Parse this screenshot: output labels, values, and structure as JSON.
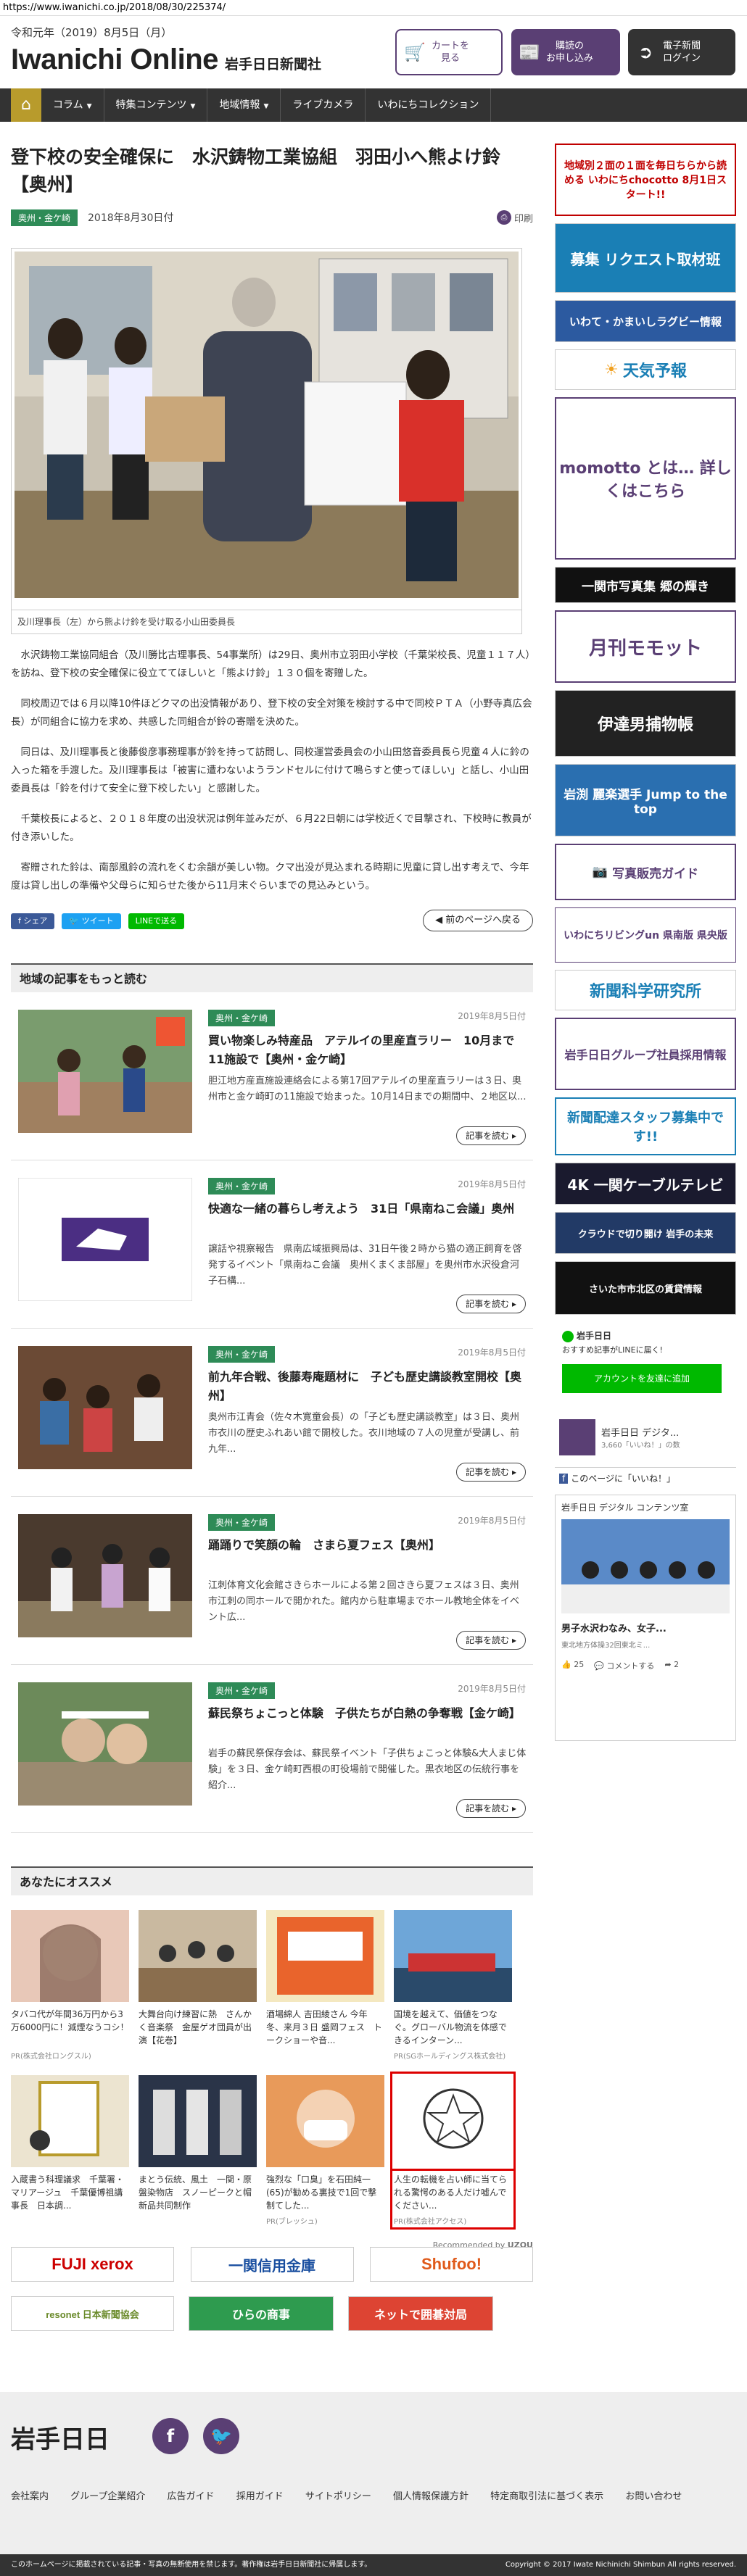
{
  "browser_url": "https://www.iwanichi.co.jp/2018/08/30/225374/",
  "header": {
    "date": "令和元年（2019）8月5日（月）",
    "logo": "Iwanichi Online",
    "logo_jp": "岩手日日新聞社",
    "buttons": [
      {
        "label": "カートを\n見る",
        "icon": "cart-icon"
      },
      {
        "label": "購読の\nお申し込み",
        "icon": "newspaper-icon"
      },
      {
        "label": "電子新聞\nログイン",
        "icon": "login-icon"
      }
    ]
  },
  "nav": [
    "コラム",
    "特集コンテンツ",
    "地域情報",
    "ライブカメラ",
    "いわにちコレクション"
  ],
  "article": {
    "title": "登下校の安全確保に　水沢鋳物工業協組　羽田小へ熊よけ鈴【奥州】",
    "tag": "奥州・金ケ崎",
    "date": "2018年8月30日付",
    "print": "印刷",
    "caption": "及川理事長（左）から熊よけ鈴を受け取る小山田委員長",
    "paragraphs": [
      "水沢鋳物工業協同組合（及川勝比古理事長、54事業所）は29日、奥州市立羽田小学校（千葉栄校長、児童１１７人）を訪ね、登下校の安全確保に役立ててほしいと「熊よけ鈴」１３０個を寄贈した。",
      "同校周辺では６月以降10件ほどクマの出没情報があり、登下校の安全対策を検討する中で同校ＰＴＡ（小野寺真広会長）が同組合に協力を求め、共感した同組合が鈴の寄贈を決めた。",
      "同日は、及川理事長と後藤俊彦事務理事が鈴を持って訪問し、同校運営委員会の小山田悠音委員長ら児童４人に鈴の入った箱を手渡した。及川理事長は「被害に遭わないようランドセルに付けて鳴らすと使ってほしい」と話し、小山田委員長は「鈴を付けて安全に登下校したい」と感謝した。",
      "千葉校長によると、２０１８年度の出没状況は例年並みだが、６月22日朝には学校近くで目撃され、下校時に教員が付き添いした。",
      "寄贈された鈴は、南部風鈴の流れをくむ余韻が美しい物。クマ出没が見込まれる時期に児童に貸し出す考えで、今年度は貸し出しの準備や父母らに知らせた後から11月末ぐらいまでの見込みという。"
    ],
    "share": [
      "シェア",
      "ツイート",
      "LINEで送る"
    ],
    "back": "前のページへ戻る"
  },
  "local_section": {
    "title": "地域の記事をもっと読む",
    "more_label": "記事を読む",
    "items": [
      {
        "tag": "奥州・金ケ崎",
        "date": "2019年8月5日付",
        "title": "買い物楽しみ特産品　アテルイの里産直ラリー　10月まで11施設で【奥州・金ケ崎】",
        "summary": "胆江地方産直施設連絡会による第17回アテルイの里産直ラリーは３日、奥州市と金ケ崎町の11施設で始まった。10月14日までの期間中、２地区以..."
      },
      {
        "tag": "奥州・金ケ崎",
        "date": "2019年8月5日付",
        "title": "快適な一緒の暮らし考えよう　31日「県南ねこ会議」奥州",
        "summary": "譲話や視察報告　県南広域振興局は、31日午後２時から猫の適正飼育を啓発するイベント「県南ねこ会議　奥州くまくま部屋」を奥州市水沢役倉河子石構..."
      },
      {
        "tag": "奥州・金ケ崎",
        "date": "2019年8月5日付",
        "title": "前九年合戦、後藤寿庵題材に　子ども歴史講談教室開校【奥州】",
        "summary": "奥州市江青会（佐々木寛童会長）の「子ども歴史講談教室」は３日、奥州市衣川の歴史ふれあい館で開校した。衣川地域の７人の児童が受講し、前九年..."
      },
      {
        "tag": "奥州・金ケ崎",
        "date": "2019年8月5日付",
        "title": "踊踊りで笑顔の輪　さまら夏フェス【奥州】",
        "summary": "江刺体育文化会館さきらホールによる第２回さきら夏フェスは３日、奥州市江刺の同ホールで開かれた。館内から駐車場までホール教地全体をイベント広..."
      },
      {
        "tag": "奥州・金ケ崎",
        "date": "2019年8月5日付",
        "title": "蘇民祭ちょこっと体験　子供たちが白熱の争奪戦【金ケ崎】",
        "summary": "岩手の蘇民祭保存会は、蘇民祭イベント「子供ちょこっと体験&大人まじ体験」を３日、金ケ崎町西根の町役場前で開催した。黒衣地区の伝統行事を紹介..."
      }
    ]
  },
  "recommend": {
    "title": "あなたにオススメ",
    "items": [
      {
        "title": "タバコ代が年間36万円から3万6000円に！減煙なうコシ！",
        "source": "PR(株式会社ロングスル)"
      },
      {
        "title": "大舞台向け練習に熱　さんかく音楽祭　金屋ゲオ団員が出演【花巻】",
        "source": ""
      },
      {
        "title": "酒場綿人 吉田綾さん 今年冬、来月３日 盛岡フェス　トークショーや音...",
        "source": ""
      },
      {
        "title": "国境を越えて、価値をつなぐ。グローバル物流を体感できるインターン...",
        "source": "PR(SGホールディングス株式会社)"
      },
      {
        "title": "入蔵書う科理議求　千葉署・マリアージュ　千葉優博祖講事長　日本調...",
        "source": ""
      },
      {
        "title": "まとう伝統、風土　一関・原盤染物店　スノーピークと帽新品共同制作",
        "source": ""
      },
      {
        "title": "強烈な「口臭」を石田純一(65)が勧める裏技で1回で撃制てした...",
        "source": "PR(ブレッシュ)"
      },
      {
        "title": "人生の転機を占い師に当てられる驚愕のある人だけ嘘んでください...",
        "source": "PR(株式会社アクセス)"
      }
    ],
    "powered_by": "Recommended by",
    "powered_brand": "UZOU"
  },
  "sidebar": {
    "banners": [
      {
        "text": "地域別２面の１面を毎日ちらから読める いわにちchocotto 8月1日スタート!!",
        "bg": "#ffffff",
        "fg": "#c00000",
        "name": "chocotto-banner"
      },
      {
        "text": "募集 リクエスト取材班",
        "bg": "#1a7fb5",
        "fg": "#ffffff",
        "name": "request-banner"
      },
      {
        "text": "いわて・かまいしラグビー情報",
        "bg": "#2c5aa0",
        "fg": "#ffffff",
        "name": "rugby-banner"
      },
      {
        "text": "天気予報",
        "bg": "#ffffff",
        "fg": "#1a7fb5",
        "name": "weather-banner"
      },
      {
        "text": "momotto とは… 詳しくはこちら",
        "bg": "#ffffff",
        "fg": "#5a3f74",
        "name": "momotto-banner"
      },
      {
        "text": "一関市写真集 郷の輝き",
        "bg": "#111111",
        "fg": "#ffffff",
        "name": "photo-book-banner"
      },
      {
        "text": "月刊モモット",
        "bg": "#ffffff",
        "fg": "#5a3f74",
        "name": "momotto-monthly-banner"
      },
      {
        "text": "伊達男捕物帳",
        "bg": "#222222",
        "fg": "#ffffff",
        "name": "torimono-banner"
      },
      {
        "text": "岩渕 麗楽選手 Jump to the top",
        "bg": "#2a6fb0",
        "fg": "#ffffff",
        "name": "jump-banner"
      },
      {
        "text": "写真販売ガイド",
        "bg": "#ffffff",
        "fg": "#5a3f74",
        "name": "photo-sales-banner"
      },
      {
        "text": "いわにちリビングun 県南版 県央版",
        "bg": "#ffffff",
        "fg": "#5a3f74",
        "name": "living-banner"
      },
      {
        "text": "新聞科学研究所",
        "bg": "#ffffff",
        "fg": "#1a7fb5",
        "name": "science-banner"
      },
      {
        "text": "岩手日日グループ社員採用情報",
        "bg": "#ffffff",
        "fg": "#5a3f74",
        "name": "recruit-banner"
      },
      {
        "text": "新聞配達スタッフ募集中です!!",
        "bg": "#ffffff",
        "fg": "#1a7fb5",
        "name": "delivery-banner"
      },
      {
        "text": "4K 一関ケーブルテレビ",
        "bg": "#1a1a2e",
        "fg": "#ffffff",
        "name": "tv4k-banner"
      },
      {
        "text": "クラウドで切り開け 岩手の未来",
        "bg": "#223a66",
        "fg": "#ffffff",
        "name": "cloud-banner"
      },
      {
        "text": "さいた市市北区の賃貸情報",
        "bg": "#111111",
        "fg": "#ffffff",
        "name": "rental-banner"
      }
    ],
    "line_box": {
      "title": "岩手日日",
      "subtitle": "おすすめ記事がLINEに届く!",
      "button": "アカウントを友達に追加"
    },
    "page_name": "岩手日日 デジタ...",
    "page_likes": "3,660「いいね！」の数",
    "fb_like_label": "このページに「いいね！」",
    "fb_post": {
      "name": "岩手日日 デジタル コンテンツ室",
      "title": "男子水沢わなみ、女子...",
      "sub": "東北地方体操32回東北ミ...",
      "likes": "25",
      "comments": "コメントする",
      "shares": "2"
    }
  },
  "sponsors": [
    "FUJI xerox",
    "一関信用金庫",
    "Shufoo!",
    "resonet 日本新聞協会",
    "ひらの商事",
    "ネットで囲碁対局"
  ],
  "footer": {
    "logo": "岩手日日",
    "links": [
      "会社案内",
      "グループ企業紹介",
      "広告ガイド",
      "採用ガイド",
      "サイトポリシー",
      "個人情報保護方針",
      "特定商取引法に基づく表示",
      "お問い合わせ"
    ],
    "notice": "このホームページに掲載されている記事・写真の無断使用を禁じます。著作権は岩手日日新聞社に帰属します。",
    "copyright": "Copyright © 2017 Iwate Nichinichi Shimbun All rights reserved."
  },
  "colors": {
    "brand": "#5a3f74",
    "tag": "#2e8b57",
    "nav": "#333333",
    "home": "#b89b2c"
  }
}
